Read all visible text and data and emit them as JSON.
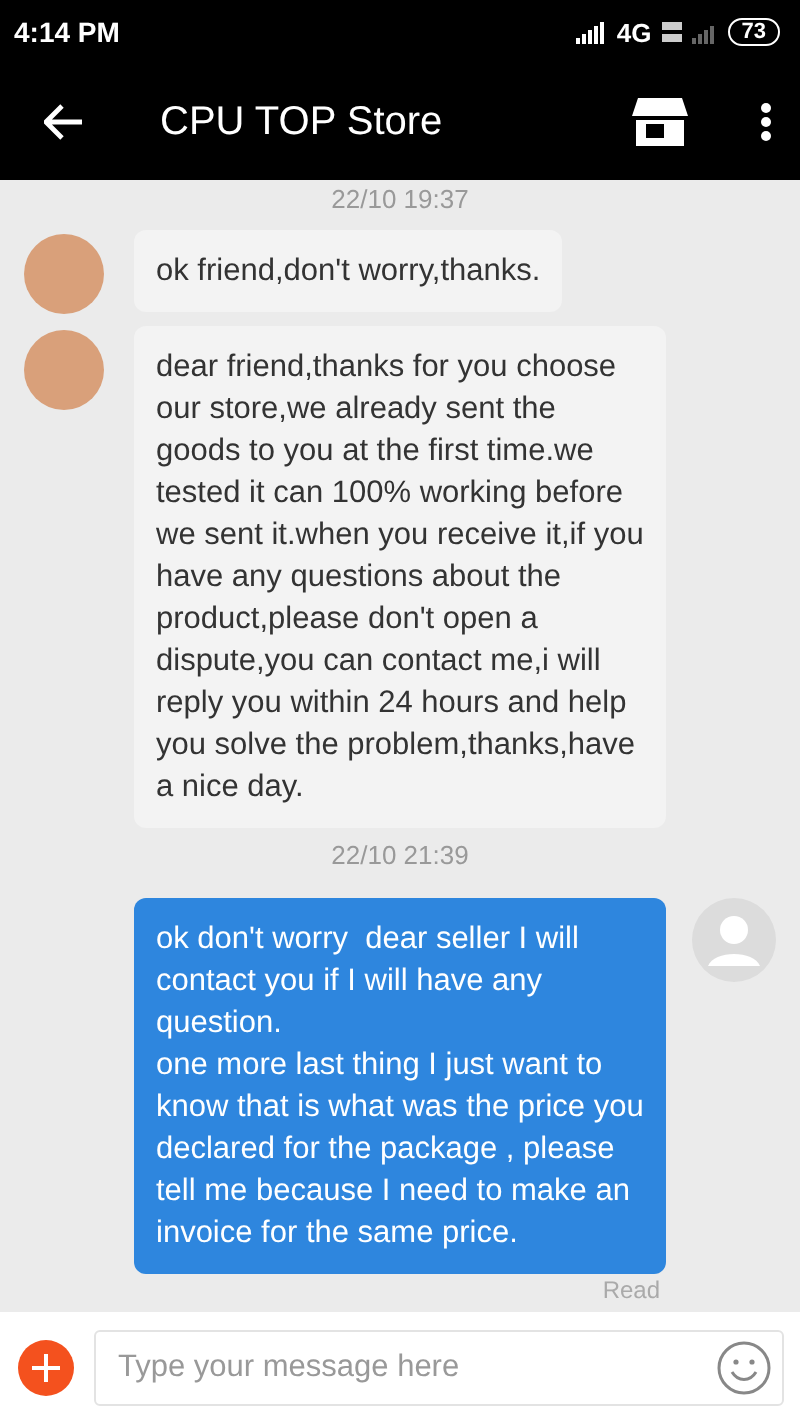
{
  "status_bar": {
    "time": "4:14 PM",
    "network": "4G",
    "battery": "73"
  },
  "header": {
    "title": "CPU TOP Store"
  },
  "messages": [
    {
      "kind": "time",
      "text": "22/10 19:37"
    },
    {
      "kind": "received",
      "text": "ok friend,don't worry,thanks."
    },
    {
      "kind": "received",
      "text": "dear friend,thanks for you choose our store,we already sent the goods to you at the first time.we tested it can 100% working before we sent it.when you receive it,if you have any questions about the product,please don't open a dispute,you can contact me,i will reply you within 24 hours and help you solve the problem,thanks,have a nice day."
    },
    {
      "kind": "time",
      "text": "22/10 21:39"
    },
    {
      "kind": "sent",
      "text": "ok don't worry  dear seller I will contact you if I will have any question.\none more last thing I just want to know that is what was the price you declared for the package , please tell me because I need to make an invoice for the same price.",
      "status": "Read"
    }
  ],
  "composer": {
    "placeholder": "Type your message here"
  }
}
